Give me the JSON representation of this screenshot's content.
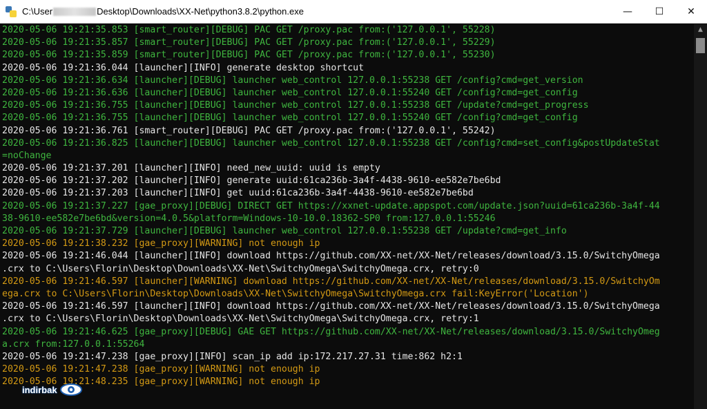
{
  "window": {
    "title_prefix": "C:\\User",
    "title_suffix": "Desktop\\Downloads\\XX-Net\\python3.8.2\\python.exe",
    "controls": {
      "minimize": "—",
      "maximize": "☐",
      "close": "✕"
    }
  },
  "colors": {
    "debug": "#3fb63f",
    "info": "#e6e6e6",
    "warning": "#d49a14",
    "background": "#0c0c0c"
  },
  "console": {
    "lines": [
      {
        "level": "debug",
        "text": "2020-05-06 19:21:35.853 [smart_router][DEBUG] PAC GET /proxy.pac from:('127.0.0.1', 55228)"
      },
      {
        "level": "debug",
        "text": "2020-05-06 19:21:35.857 [smart_router][DEBUG] PAC GET /proxy.pac from:('127.0.0.1', 55229)"
      },
      {
        "level": "debug",
        "text": "2020-05-06 19:21:35.859 [smart_router][DEBUG] PAC GET /proxy.pac from:('127.0.0.1', 55230)"
      },
      {
        "level": "info",
        "text": "2020-05-06 19:21:36.044 [launcher][INFO] generate desktop shortcut"
      },
      {
        "level": "debug",
        "text": "2020-05-06 19:21:36.634 [launcher][DEBUG] launcher web_control 127.0.0.1:55238 GET /config?cmd=get_version"
      },
      {
        "level": "debug",
        "text": "2020-05-06 19:21:36.636 [launcher][DEBUG] launcher web_control 127.0.0.1:55240 GET /config?cmd=get_config"
      },
      {
        "level": "debug",
        "text": "2020-05-06 19:21:36.755 [launcher][DEBUG] launcher web_control 127.0.0.1:55238 GET /update?cmd=get_progress"
      },
      {
        "level": "debug",
        "text": "2020-05-06 19:21:36.755 [launcher][DEBUG] launcher web_control 127.0.0.1:55240 GET /config?cmd=get_config"
      },
      {
        "level": "info",
        "text": "2020-05-06 19:21:36.761 [smart_router][DEBUG] PAC GET /proxy.pac from:('127.0.0.1', 55242)"
      },
      {
        "level": "debug",
        "text": "2020-05-06 19:21:36.825 [launcher][DEBUG] launcher web_control 127.0.0.1:55238 GET /config?cmd=set_config&postUpdateStat"
      },
      {
        "level": "debug",
        "text": "=noChange"
      },
      {
        "level": "info",
        "text": "2020-05-06 19:21:37.201 [launcher][INFO] need_new_uuid: uuid is empty"
      },
      {
        "level": "info",
        "text": "2020-05-06 19:21:37.202 [launcher][INFO] generate uuid:61ca236b-3a4f-4438-9610-ee582e7be6bd"
      },
      {
        "level": "info",
        "text": "2020-05-06 19:21:37.203 [launcher][INFO] get uuid:61ca236b-3a4f-4438-9610-ee582e7be6bd"
      },
      {
        "level": "debug",
        "text": "2020-05-06 19:21:37.227 [gae_proxy][DEBUG] DIRECT GET https://xxnet-update.appspot.com/update.json?uuid=61ca236b-3a4f-44"
      },
      {
        "level": "debug",
        "text": "38-9610-ee582e7be6bd&version=4.0.5&platform=Windows-10-10.0.18362-SP0 from:127.0.0.1:55246"
      },
      {
        "level": "debug",
        "text": "2020-05-06 19:21:37.729 [launcher][DEBUG] launcher web_control 127.0.0.1:55238 GET /update?cmd=get_info"
      },
      {
        "level": "warn",
        "text": "2020-05-06 19:21:38.232 [gae_proxy][WARNING] not enough ip"
      },
      {
        "level": "info",
        "text": "2020-05-06 19:21:46.044 [launcher][INFO] download https://github.com/XX-net/XX-Net/releases/download/3.15.0/SwitchyOmega"
      },
      {
        "level": "info",
        "text": ".crx to C:\\Users\\Florin\\Desktop\\Downloads\\XX-Net\\SwitchyOmega\\SwitchyOmega.crx, retry:0"
      },
      {
        "level": "warn",
        "text": "2020-05-06 19:21:46.597 [launcher][WARNING] download https://github.com/XX-net/XX-Net/releases/download/3.15.0/SwitchyOm"
      },
      {
        "level": "warn",
        "text": "ega.crx to C:\\Users\\Florin\\Desktop\\Downloads\\XX-Net\\SwitchyOmega\\SwitchyOmega.crx fail:KeyError('Location')"
      },
      {
        "level": "info",
        "text": "2020-05-06 19:21:46.597 [launcher][INFO] download https://github.com/XX-net/XX-Net/releases/download/3.15.0/SwitchyOmega"
      },
      {
        "level": "info",
        "text": ".crx to C:\\Users\\Florin\\Desktop\\Downloads\\XX-Net\\SwitchyOmega\\SwitchyOmega.crx, retry:1"
      },
      {
        "level": "debug",
        "text": "2020-05-06 19:21:46.625 [gae_proxy][DEBUG] GAE GET https://github.com/XX-net/XX-Net/releases/download/3.15.0/SwitchyOmeg"
      },
      {
        "level": "debug",
        "text": "a.crx from:127.0.0.1:55264"
      },
      {
        "level": "info",
        "text": "2020-05-06 19:21:47.238 [gae_proxy][INFO] scan_ip add ip:172.217.27.31 time:862 h2:1"
      },
      {
        "level": "warn",
        "text": "2020-05-06 19:21:47.238 [gae_proxy][WARNING] not enough ip"
      },
      {
        "level": "warn",
        "text": "2020-05-06 19:21:48.235 [gae_proxy][WARNING] not enough ip"
      }
    ]
  },
  "watermark": {
    "text": "indirbak"
  }
}
